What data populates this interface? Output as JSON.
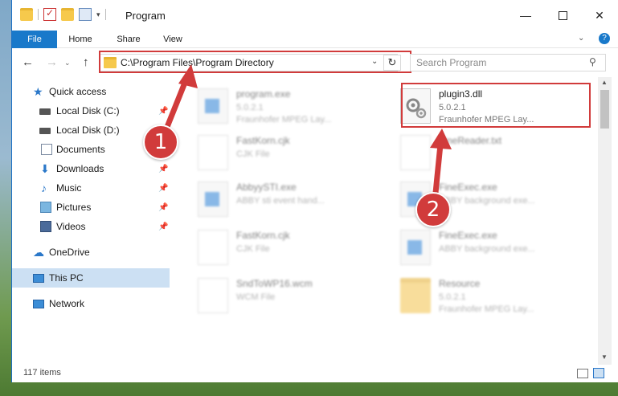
{
  "window": {
    "title": "Program",
    "controls": {
      "minimize": "—",
      "close": "✕"
    }
  },
  "ribbon": {
    "tabs": [
      "File",
      "Home",
      "Share",
      "View"
    ],
    "expand_glyph": "⌄",
    "help_glyph": "?"
  },
  "navigation": {
    "back_glyph": "←",
    "forward_glyph": "→",
    "recent_glyph": "⌄",
    "up_glyph": "↑",
    "address": "C:\\Program Files\\Program Directory",
    "address_dropdown_glyph": "⌄",
    "refresh_glyph": "↻",
    "search_placeholder": "Search Program",
    "search_glyph": "⚲"
  },
  "sidebar": {
    "items": [
      {
        "label": "Quick access",
        "icon": "star-icon",
        "glyph": "★"
      },
      {
        "label": "Local Disk (C:)",
        "icon": "drive-icon",
        "pinned": true
      },
      {
        "label": "Local Disk (D:)",
        "icon": "drive-icon"
      },
      {
        "label": "Documents",
        "icon": "document-icon",
        "pinned": true
      },
      {
        "label": "Downloads",
        "icon": "download-icon",
        "glyph": "⬇",
        "pinned": true
      },
      {
        "label": "Music",
        "icon": "music-icon",
        "glyph": "♪",
        "pinned": true
      },
      {
        "label": "Pictures",
        "icon": "pictures-icon",
        "pinned": true
      },
      {
        "label": "Videos",
        "icon": "videos-icon",
        "pinned": true
      },
      {
        "label": "OneDrive",
        "icon": "cloud-icon",
        "glyph": "☁"
      },
      {
        "label": "This PC",
        "icon": "computer-icon",
        "selected": true
      },
      {
        "label": "Network",
        "icon": "network-icon"
      }
    ],
    "pin_glyph": "📌"
  },
  "files": [
    {
      "name": "program.exe",
      "version": "5.0.2.1",
      "type": "Fraunhofer MPEG Lay...",
      "icon": "exe-icon"
    },
    {
      "name": "plugin3.dll",
      "version": "5.0.2.1",
      "type": "Fraunhofer MPEG Lay...",
      "icon": "dll-gear-icon"
    },
    {
      "name": "FastKorn.cjk",
      "type": "CJK File",
      "icon": "file-icon"
    },
    {
      "name": "FineReader.txt",
      "type": "",
      "icon": "file-icon"
    },
    {
      "name": "AbbyySTI.exe",
      "type": "ABBY sti event hand...",
      "icon": "exe-icon"
    },
    {
      "name": "FineExec.exe",
      "type": "ABBY background exe...",
      "icon": "exe-icon"
    },
    {
      "name": "FastKorn.cjk",
      "type": "CJK File",
      "icon": "file-icon"
    },
    {
      "name": "FineExec.exe",
      "type": "ABBY background exe...",
      "icon": "exe-icon"
    },
    {
      "name": "SndToWP16.wcm",
      "type": "WCM File",
      "icon": "file-icon"
    },
    {
      "name": "Resource",
      "version": "5.0.2.1",
      "type": "Fraunhofer MPEG Lay...",
      "icon": "folder-icon"
    }
  ],
  "status": {
    "item_count": "117 items"
  },
  "scrollbar": {
    "up_glyph": "▲",
    "down_glyph": "▼"
  },
  "annotations": {
    "step1": "1",
    "step2": "2",
    "color": "#d13b3b"
  }
}
